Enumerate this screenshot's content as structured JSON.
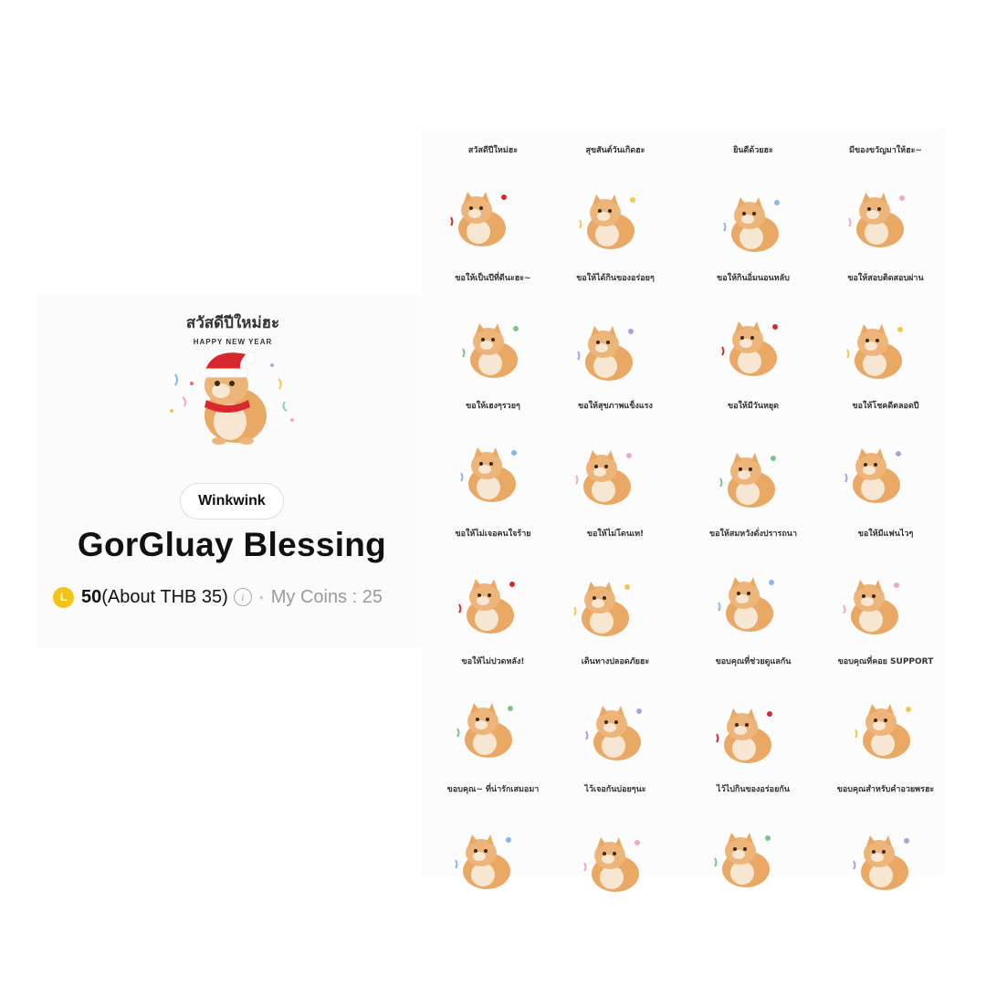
{
  "hero": {
    "caption": "สวัสดีปีใหม่ฮะ",
    "subcaption": "HAPPY NEW YEAR"
  },
  "author": "Winkwink",
  "title": "GorGluay Blessing",
  "price": {
    "coin_letter": "L",
    "amount": "50",
    "approx": "(About THB 35)",
    "my_coins": "My Coins : 25"
  },
  "colors": {
    "coin": "#f3c315",
    "cat_orange": "#e9a864",
    "cat_cream": "#f6e6d2"
  },
  "stickers": [
    {
      "caption": "สวัสดีปีใหม่ฮะ",
      "icon": "cat-santa-hat-icon"
    },
    {
      "caption": "สุขสันต์วันเกิดฮะ",
      "icon": "cat-party-glasses-icon"
    },
    {
      "caption": "ยินดีด้วยฮะ",
      "icon": "cat-confetti-icon"
    },
    {
      "caption": "มีของขวัญมาให้ฮะ~",
      "icon": "cats-gift-box-icon"
    },
    {
      "caption": "ขอให้เป็นปีที่ดีนะฮะ~",
      "icon": "cat-heart-icon"
    },
    {
      "caption": "ขอให้ได้กินของอร่อยๆ",
      "icon": "cat-chef-hat-icon"
    },
    {
      "caption": "ขอให้กินอิ่มนอนหลับ",
      "icon": "cat-sleeping-icon"
    },
    {
      "caption": "ขอให้สอบติดสอบผ่าน",
      "icon": "cat-graduation-cap-icon"
    },
    {
      "caption": "ขอให้เฮงๆรวยๆ",
      "icon": "cat-money-icon"
    },
    {
      "caption": "ขอให้สุขภาพแข็งแรง",
      "icon": "cat-flexing-icon"
    },
    {
      "caption": "ขอให้มีวันหยุด",
      "icon": "cat-christmas-tree-icon"
    },
    {
      "caption": "ขอให้โชคดีตลอดปี",
      "icon": "cat-clover-icon"
    },
    {
      "caption": "ขอให้ไม่เจอคนใจร้าย",
      "icon": "cat-pink-bonnet-icon"
    },
    {
      "caption": "ขอให้ไม่โดนเท!",
      "icon": "cat-lying-icon"
    },
    {
      "caption": "ขอให้สมหวังดั่งปรารถนา",
      "icon": "cat-bowtie-icon"
    },
    {
      "caption": "ขอให้มีแฟนไวๆ",
      "icon": "cats-couple-icon"
    },
    {
      "caption": "ขอให้ไม่ปวดหลัง!",
      "icon": "cat-curled-icon"
    },
    {
      "caption": "เดินทางปลอดภัยฮะ",
      "icon": "cat-school-bus-icon"
    },
    {
      "caption": "ขอบคุณที่ช่วยดูแลกัน",
      "icon": "cat-stretching-icon"
    },
    {
      "caption": "ขอบคุณที่คอย SUPPORT",
      "icon": "cat-purple-bow-icon"
    },
    {
      "caption": "ขอบคุณ~ ที่น่ารักเสมอมา",
      "icon": "cat-bear-ears-icon"
    },
    {
      "caption": "ไว้เจอกันบ่อยๆนะ",
      "icon": "cat-peeking-icon"
    },
    {
      "caption": "ไว้ไปกินของอร่อยกัน",
      "icon": "cats-cuddling-icon"
    },
    {
      "caption": "ขอบคุณสำหรับคำอวยพรฮะ",
      "icon": "cat-hearts-icon"
    }
  ]
}
